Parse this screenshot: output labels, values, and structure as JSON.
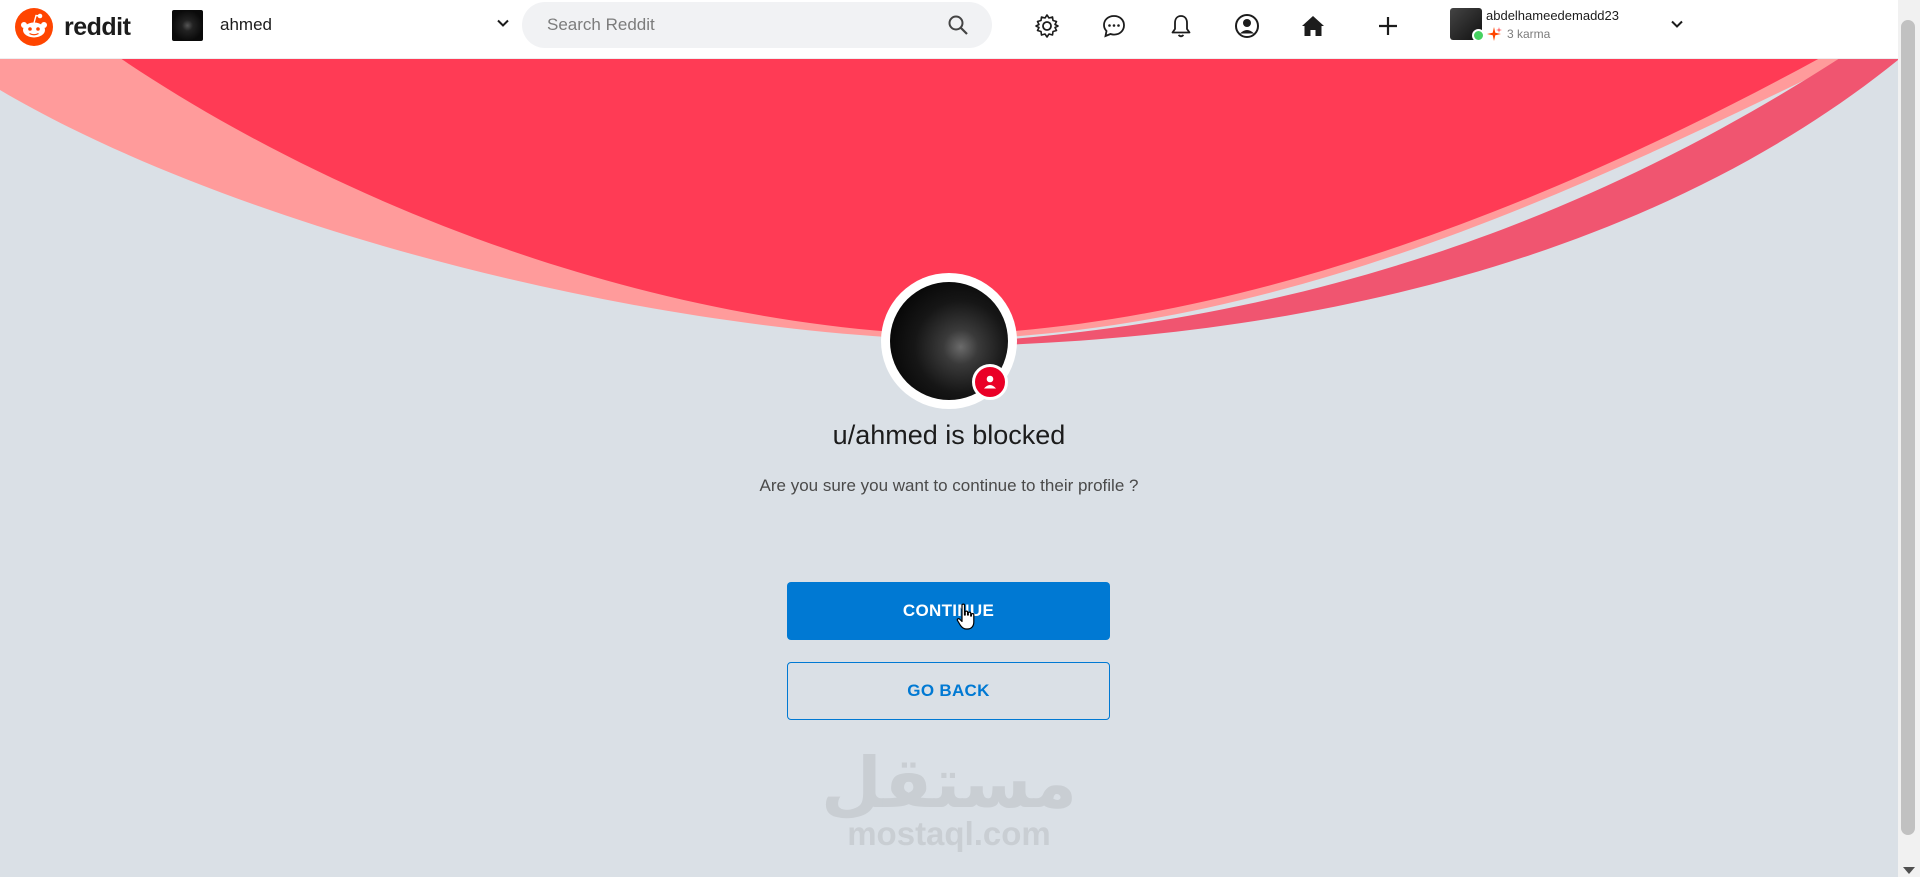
{
  "app": {
    "brand": "reddit",
    "accent": "#ff4500"
  },
  "header": {
    "community": {
      "name": "ahmed"
    },
    "search": {
      "placeholder": "Search Reddit"
    },
    "icons": [
      "gear-icon",
      "chat-icon",
      "bell-icon",
      "profile-icon",
      "home-icon",
      "plus-icon"
    ],
    "user": {
      "name": "abdelhameedemadd23",
      "karma": "3 karma"
    }
  },
  "blocked": {
    "title": "u/ahmed is blocked",
    "message": "Are you sure you want to continue to their profile ?",
    "continue_label": "CONTINUE",
    "back_label": "GO BACK"
  },
  "watermark": {
    "arabic": "مستقل",
    "latin": "mostaql.com"
  },
  "colors": {
    "primary": "#0079d3",
    "banner_red": "#ff3b55",
    "banner_light": "#ff9b9b",
    "banner_pink": "#f05570",
    "background": "#dae0e6",
    "blocked_badge": "#ea0027"
  }
}
